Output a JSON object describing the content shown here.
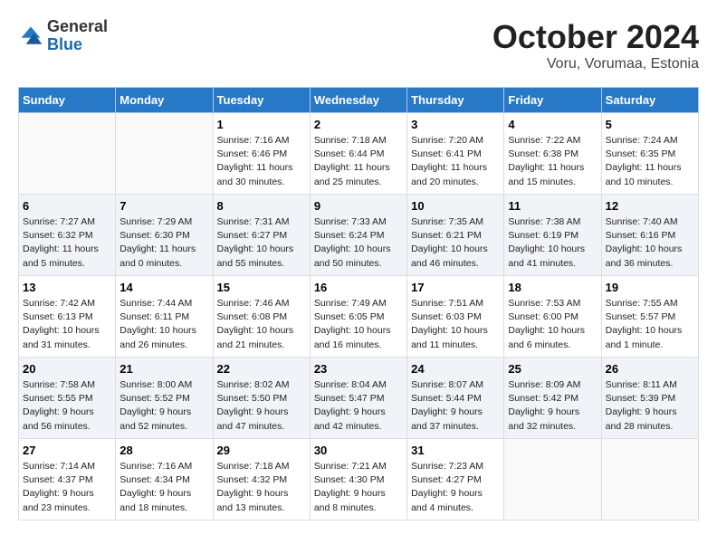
{
  "logo": {
    "general": "General",
    "blue": "Blue"
  },
  "title": {
    "month": "October 2024",
    "location": "Voru, Vorumaa, Estonia"
  },
  "headers": [
    "Sunday",
    "Monday",
    "Tuesday",
    "Wednesday",
    "Thursday",
    "Friday",
    "Saturday"
  ],
  "weeks": [
    [
      {
        "day": "",
        "info": ""
      },
      {
        "day": "",
        "info": ""
      },
      {
        "day": "1",
        "info": "Sunrise: 7:16 AM\nSunset: 6:46 PM\nDaylight: 11 hours and 30 minutes."
      },
      {
        "day": "2",
        "info": "Sunrise: 7:18 AM\nSunset: 6:44 PM\nDaylight: 11 hours and 25 minutes."
      },
      {
        "day": "3",
        "info": "Sunrise: 7:20 AM\nSunset: 6:41 PM\nDaylight: 11 hours and 20 minutes."
      },
      {
        "day": "4",
        "info": "Sunrise: 7:22 AM\nSunset: 6:38 PM\nDaylight: 11 hours and 15 minutes."
      },
      {
        "day": "5",
        "info": "Sunrise: 7:24 AM\nSunset: 6:35 PM\nDaylight: 11 hours and 10 minutes."
      }
    ],
    [
      {
        "day": "6",
        "info": "Sunrise: 7:27 AM\nSunset: 6:32 PM\nDaylight: 11 hours and 5 minutes."
      },
      {
        "day": "7",
        "info": "Sunrise: 7:29 AM\nSunset: 6:30 PM\nDaylight: 11 hours and 0 minutes."
      },
      {
        "day": "8",
        "info": "Sunrise: 7:31 AM\nSunset: 6:27 PM\nDaylight: 10 hours and 55 minutes."
      },
      {
        "day": "9",
        "info": "Sunrise: 7:33 AM\nSunset: 6:24 PM\nDaylight: 10 hours and 50 minutes."
      },
      {
        "day": "10",
        "info": "Sunrise: 7:35 AM\nSunset: 6:21 PM\nDaylight: 10 hours and 46 minutes."
      },
      {
        "day": "11",
        "info": "Sunrise: 7:38 AM\nSunset: 6:19 PM\nDaylight: 10 hours and 41 minutes."
      },
      {
        "day": "12",
        "info": "Sunrise: 7:40 AM\nSunset: 6:16 PM\nDaylight: 10 hours and 36 minutes."
      }
    ],
    [
      {
        "day": "13",
        "info": "Sunrise: 7:42 AM\nSunset: 6:13 PM\nDaylight: 10 hours and 31 minutes."
      },
      {
        "day": "14",
        "info": "Sunrise: 7:44 AM\nSunset: 6:11 PM\nDaylight: 10 hours and 26 minutes."
      },
      {
        "day": "15",
        "info": "Sunrise: 7:46 AM\nSunset: 6:08 PM\nDaylight: 10 hours and 21 minutes."
      },
      {
        "day": "16",
        "info": "Sunrise: 7:49 AM\nSunset: 6:05 PM\nDaylight: 10 hours and 16 minutes."
      },
      {
        "day": "17",
        "info": "Sunrise: 7:51 AM\nSunset: 6:03 PM\nDaylight: 10 hours and 11 minutes."
      },
      {
        "day": "18",
        "info": "Sunrise: 7:53 AM\nSunset: 6:00 PM\nDaylight: 10 hours and 6 minutes."
      },
      {
        "day": "19",
        "info": "Sunrise: 7:55 AM\nSunset: 5:57 PM\nDaylight: 10 hours and 1 minute."
      }
    ],
    [
      {
        "day": "20",
        "info": "Sunrise: 7:58 AM\nSunset: 5:55 PM\nDaylight: 9 hours and 56 minutes."
      },
      {
        "day": "21",
        "info": "Sunrise: 8:00 AM\nSunset: 5:52 PM\nDaylight: 9 hours and 52 minutes."
      },
      {
        "day": "22",
        "info": "Sunrise: 8:02 AM\nSunset: 5:50 PM\nDaylight: 9 hours and 47 minutes."
      },
      {
        "day": "23",
        "info": "Sunrise: 8:04 AM\nSunset: 5:47 PM\nDaylight: 9 hours and 42 minutes."
      },
      {
        "day": "24",
        "info": "Sunrise: 8:07 AM\nSunset: 5:44 PM\nDaylight: 9 hours and 37 minutes."
      },
      {
        "day": "25",
        "info": "Sunrise: 8:09 AM\nSunset: 5:42 PM\nDaylight: 9 hours and 32 minutes."
      },
      {
        "day": "26",
        "info": "Sunrise: 8:11 AM\nSunset: 5:39 PM\nDaylight: 9 hours and 28 minutes."
      }
    ],
    [
      {
        "day": "27",
        "info": "Sunrise: 7:14 AM\nSunset: 4:37 PM\nDaylight: 9 hours and 23 minutes."
      },
      {
        "day": "28",
        "info": "Sunrise: 7:16 AM\nSunset: 4:34 PM\nDaylight: 9 hours and 18 minutes."
      },
      {
        "day": "29",
        "info": "Sunrise: 7:18 AM\nSunset: 4:32 PM\nDaylight: 9 hours and 13 minutes."
      },
      {
        "day": "30",
        "info": "Sunrise: 7:21 AM\nSunset: 4:30 PM\nDaylight: 9 hours and 8 minutes."
      },
      {
        "day": "31",
        "info": "Sunrise: 7:23 AM\nSunset: 4:27 PM\nDaylight: 9 hours and 4 minutes."
      },
      {
        "day": "",
        "info": ""
      },
      {
        "day": "",
        "info": ""
      }
    ]
  ]
}
